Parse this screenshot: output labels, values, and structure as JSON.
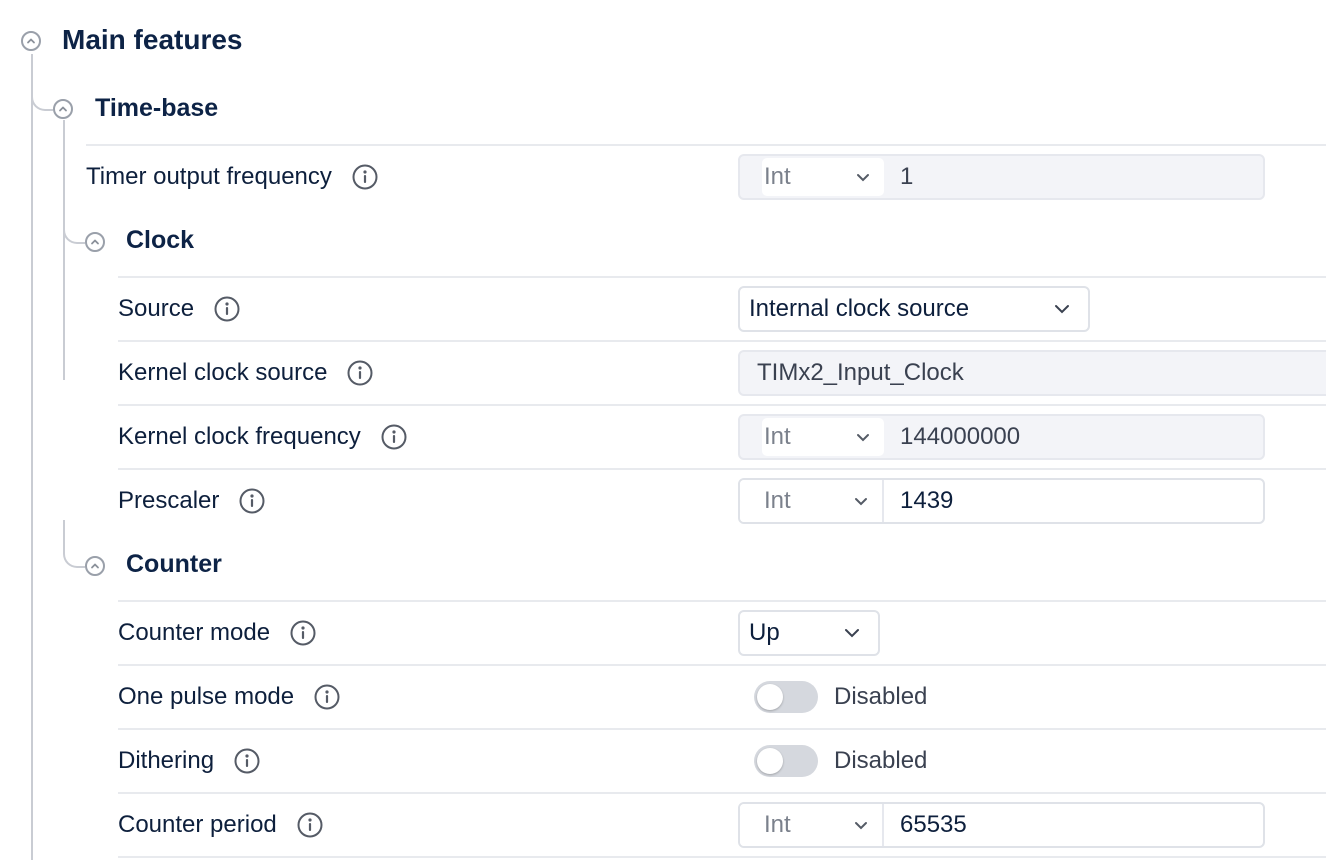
{
  "sections": {
    "main_features": "Main features",
    "time_base": "Time-base",
    "clock": "Clock",
    "counter": "Counter"
  },
  "fields": {
    "timer_output_frequency": {
      "label": "Timer output frequency",
      "type": "Int",
      "value": "1",
      "readonly": true
    },
    "source": {
      "label": "Source",
      "value": "Internal clock source"
    },
    "kernel_clock_source": {
      "label": "Kernel clock source",
      "value": "TIMx2_Input_Clock",
      "readonly": true
    },
    "kernel_clock_frequency": {
      "label": "Kernel clock frequency",
      "type": "Int",
      "value": "144000000",
      "readonly": true
    },
    "prescaler": {
      "label": "Prescaler",
      "type": "Int",
      "value": "1439"
    },
    "counter_mode": {
      "label": "Counter mode",
      "value": "Up"
    },
    "one_pulse_mode": {
      "label": "One pulse mode",
      "state": "Disabled",
      "enabled": false
    },
    "dithering": {
      "label": "Dithering",
      "state": "Disabled",
      "enabled": false
    },
    "counter_period": {
      "label": "Counter period",
      "type": "Int",
      "value": "65535"
    }
  },
  "colors": {
    "heading": "#0d2346",
    "tree_line": "#c9ccd3",
    "toggle_off": "#d5d8de",
    "readonly_bg": "#f3f4f8"
  }
}
